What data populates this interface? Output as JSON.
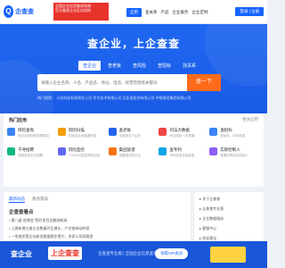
{
  "header": {
    "logo_text": "企查查",
    "red_badge_lines": [
      "全国企业信用查询系统",
      "官方备案企业征信机构"
    ],
    "nav_items": [
      "应用",
      "查关系",
      "产品",
      "企业服务",
      "企业定制"
    ],
    "login_label": "登录 | 注册"
  },
  "hero": {
    "slogan": "查企业，上企查查",
    "tabs": [
      "查企业",
      "查老板",
      "查风险",
      "查招标",
      "找关系"
    ],
    "search": {
      "placeholder": "请输入企业名称、人名、产品名、地址、电话、经营范围等关键词",
      "button_label": "查一下"
    },
    "hot_text": "热门搜索：  小米科技有限责任公司   华为技术有限公司   比亚迪股份有限公司   中铁建设集团有限公司"
  },
  "features": {
    "title": "热门应用",
    "more": "更多应用",
    "items": [
      {
        "name": "风险查询",
        "desc": "查企业风险和关联风险",
        "color": "#3b82f6"
      },
      {
        "name": "风险扫描",
        "desc": "扫描企业全维度风险",
        "color": "#f59e0b"
      },
      {
        "name": "查老板",
        "desc": "查老板名下企业",
        "color": "#2563eb"
      },
      {
        "name": "司法大数据",
        "desc": "司法风险一手掌握",
        "color": "#ef4444"
      },
      {
        "name": "查招标",
        "desc": "查标讯、中标信息",
        "color": "#3b82f6"
      },
      {
        "name": "千寻招聘",
        "desc": "快速查找企业招聘",
        "color": "#10b981"
      },
      {
        "name": "风险监控",
        "desc": "7*24小时监控风险动态",
        "color": "#6366f1"
      },
      {
        "name": "集团族谱",
        "desc": "查集团成员企业",
        "color": "#f97316"
      },
      {
        "name": "查专利",
        "desc": "专利信息全面检索",
        "color": "#0ea5e9"
      },
      {
        "name": "实际控制人",
        "desc": "穿透识别实际控制人",
        "color": "#8b5cf6"
      }
    ]
  },
  "news": {
    "tabs": [
      "最新动态",
      "热点资讯"
    ],
    "title": "企查查看点",
    "lines": [
      "• 第八届\"进博会\"签约项目总额创新高",
      "• 上周新增注册企业数量环比增长，产业链带动明显",
      "• 一季度民营企业新设数量稳步提升，多家公司获融资"
    ]
  },
  "side": {
    "lines": [
      "▸ 关于企查查",
      "▸ 企查查专业版",
      "▸ 企业数据服务",
      "▸ 客服中心",
      "▸ 投诉建议"
    ]
  },
  "banner": {
    "t1": "查企业",
    "t2": "上企查查",
    "t3": "企查查专业版 | 全国企业信息查询",
    "t4": "领取VIP会员"
  }
}
